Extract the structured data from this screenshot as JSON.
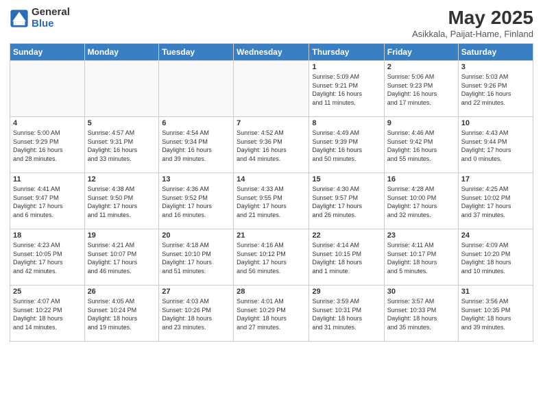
{
  "logo": {
    "line1": "General",
    "line2": "Blue"
  },
  "title": "May 2025",
  "subtitle": "Asikkala, Paijat-Hame, Finland",
  "headers": [
    "Sunday",
    "Monday",
    "Tuesday",
    "Wednesday",
    "Thursday",
    "Friday",
    "Saturday"
  ],
  "weeks": [
    [
      {
        "day": "",
        "info": ""
      },
      {
        "day": "",
        "info": ""
      },
      {
        "day": "",
        "info": ""
      },
      {
        "day": "",
        "info": ""
      },
      {
        "day": "1",
        "info": "Sunrise: 5:09 AM\nSunset: 9:21 PM\nDaylight: 16 hours\nand 11 minutes."
      },
      {
        "day": "2",
        "info": "Sunrise: 5:06 AM\nSunset: 9:23 PM\nDaylight: 16 hours\nand 17 minutes."
      },
      {
        "day": "3",
        "info": "Sunrise: 5:03 AM\nSunset: 9:26 PM\nDaylight: 16 hours\nand 22 minutes."
      }
    ],
    [
      {
        "day": "4",
        "info": "Sunrise: 5:00 AM\nSunset: 9:29 PM\nDaylight: 16 hours\nand 28 minutes."
      },
      {
        "day": "5",
        "info": "Sunrise: 4:57 AM\nSunset: 9:31 PM\nDaylight: 16 hours\nand 33 minutes."
      },
      {
        "day": "6",
        "info": "Sunrise: 4:54 AM\nSunset: 9:34 PM\nDaylight: 16 hours\nand 39 minutes."
      },
      {
        "day": "7",
        "info": "Sunrise: 4:52 AM\nSunset: 9:36 PM\nDaylight: 16 hours\nand 44 minutes."
      },
      {
        "day": "8",
        "info": "Sunrise: 4:49 AM\nSunset: 9:39 PM\nDaylight: 16 hours\nand 50 minutes."
      },
      {
        "day": "9",
        "info": "Sunrise: 4:46 AM\nSunset: 9:42 PM\nDaylight: 16 hours\nand 55 minutes."
      },
      {
        "day": "10",
        "info": "Sunrise: 4:43 AM\nSunset: 9:44 PM\nDaylight: 17 hours\nand 0 minutes."
      }
    ],
    [
      {
        "day": "11",
        "info": "Sunrise: 4:41 AM\nSunset: 9:47 PM\nDaylight: 17 hours\nand 6 minutes."
      },
      {
        "day": "12",
        "info": "Sunrise: 4:38 AM\nSunset: 9:50 PM\nDaylight: 17 hours\nand 11 minutes."
      },
      {
        "day": "13",
        "info": "Sunrise: 4:36 AM\nSunset: 9:52 PM\nDaylight: 17 hours\nand 16 minutes."
      },
      {
        "day": "14",
        "info": "Sunrise: 4:33 AM\nSunset: 9:55 PM\nDaylight: 17 hours\nand 21 minutes."
      },
      {
        "day": "15",
        "info": "Sunrise: 4:30 AM\nSunset: 9:57 PM\nDaylight: 17 hours\nand 26 minutes."
      },
      {
        "day": "16",
        "info": "Sunrise: 4:28 AM\nSunset: 10:00 PM\nDaylight: 17 hours\nand 32 minutes."
      },
      {
        "day": "17",
        "info": "Sunrise: 4:25 AM\nSunset: 10:02 PM\nDaylight: 17 hours\nand 37 minutes."
      }
    ],
    [
      {
        "day": "18",
        "info": "Sunrise: 4:23 AM\nSunset: 10:05 PM\nDaylight: 17 hours\nand 42 minutes."
      },
      {
        "day": "19",
        "info": "Sunrise: 4:21 AM\nSunset: 10:07 PM\nDaylight: 17 hours\nand 46 minutes."
      },
      {
        "day": "20",
        "info": "Sunrise: 4:18 AM\nSunset: 10:10 PM\nDaylight: 17 hours\nand 51 minutes."
      },
      {
        "day": "21",
        "info": "Sunrise: 4:16 AM\nSunset: 10:12 PM\nDaylight: 17 hours\nand 56 minutes."
      },
      {
        "day": "22",
        "info": "Sunrise: 4:14 AM\nSunset: 10:15 PM\nDaylight: 18 hours\nand 1 minute."
      },
      {
        "day": "23",
        "info": "Sunrise: 4:11 AM\nSunset: 10:17 PM\nDaylight: 18 hours\nand 5 minutes."
      },
      {
        "day": "24",
        "info": "Sunrise: 4:09 AM\nSunset: 10:20 PM\nDaylight: 18 hours\nand 10 minutes."
      }
    ],
    [
      {
        "day": "25",
        "info": "Sunrise: 4:07 AM\nSunset: 10:22 PM\nDaylight: 18 hours\nand 14 minutes."
      },
      {
        "day": "26",
        "info": "Sunrise: 4:05 AM\nSunset: 10:24 PM\nDaylight: 18 hours\nand 19 minutes."
      },
      {
        "day": "27",
        "info": "Sunrise: 4:03 AM\nSunset: 10:26 PM\nDaylight: 18 hours\nand 23 minutes."
      },
      {
        "day": "28",
        "info": "Sunrise: 4:01 AM\nSunset: 10:29 PM\nDaylight: 18 hours\nand 27 minutes."
      },
      {
        "day": "29",
        "info": "Sunrise: 3:59 AM\nSunset: 10:31 PM\nDaylight: 18 hours\nand 31 minutes."
      },
      {
        "day": "30",
        "info": "Sunrise: 3:57 AM\nSunset: 10:33 PM\nDaylight: 18 hours\nand 35 minutes."
      },
      {
        "day": "31",
        "info": "Sunrise: 3:56 AM\nSunset: 10:35 PM\nDaylight: 18 hours\nand 39 minutes."
      }
    ]
  ]
}
